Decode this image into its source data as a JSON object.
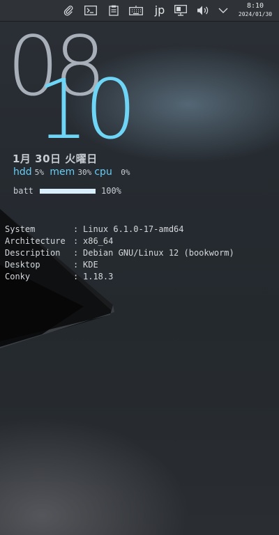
{
  "tray": {
    "icons": [
      "paperclip-icon",
      "terminal-icon",
      "clipboard-icon",
      "keyboard-icon",
      "input-language",
      "network-icon",
      "volume-icon",
      "expand-chevron-icon"
    ],
    "input_language": "jp",
    "clock_time": "8:10",
    "clock_date": "2024/01/30"
  },
  "conky": {
    "hour": "08",
    "minute": "10",
    "date": "1月 30日 火曜日",
    "stats": {
      "hdd_label": "hdd",
      "hdd_value": "5%",
      "mem_label": "mem",
      "mem_value": "30%",
      "cpu_label": "cpu",
      "cpu_value": "0%"
    },
    "battery": {
      "label": "batt",
      "level": 1.0,
      "value": "100%"
    },
    "system_info": [
      {
        "key": "System",
        "value": "Linux 6.1.0-17-amd64"
      },
      {
        "key": "Architecture",
        "value": "x86_64"
      },
      {
        "key": "Description",
        "value": "Debian GNU/Linux 12 (bookworm)"
      },
      {
        "key": "Desktop",
        "value": "KDE"
      },
      {
        "key": "Conky",
        "value": "1.18.3"
      }
    ],
    "separator": ":"
  },
  "colors": {
    "accent": "#6fd5f6",
    "hour_color": "#c4ccd6",
    "panel": "#2f3237"
  }
}
